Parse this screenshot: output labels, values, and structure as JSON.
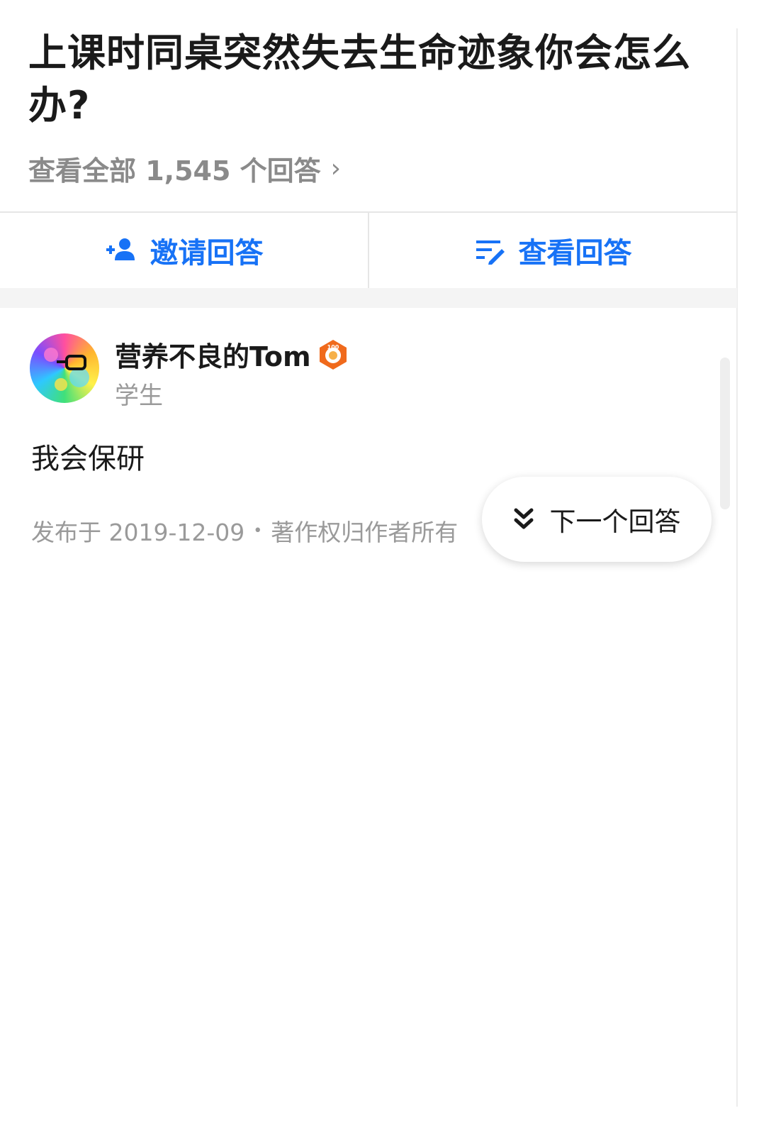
{
  "question": {
    "title": "上课时同桌突然失去生命迹象你会怎么办?",
    "all_answers_label": "查看全部 1,545 个回答"
  },
  "actions": {
    "invite_label": "邀请回答",
    "view_label": "查看回答"
  },
  "answer": {
    "author_name": "营养不良的Tom",
    "author_bio": "学生",
    "badge_text": "100",
    "content": "我会保研",
    "published": "发布于 2019-12-09",
    "copyright": "著作权归作者所有"
  },
  "next_answer": {
    "label": "下一个回答"
  },
  "colors": {
    "accent": "#1772f6",
    "muted": "#9a9a9a",
    "badge": "#f06a1c"
  },
  "icons": {
    "invite": "add-person-icon",
    "view": "list-edit-icon",
    "chevron": "chevron-right-icon",
    "next": "double-chevron-down-icon"
  }
}
